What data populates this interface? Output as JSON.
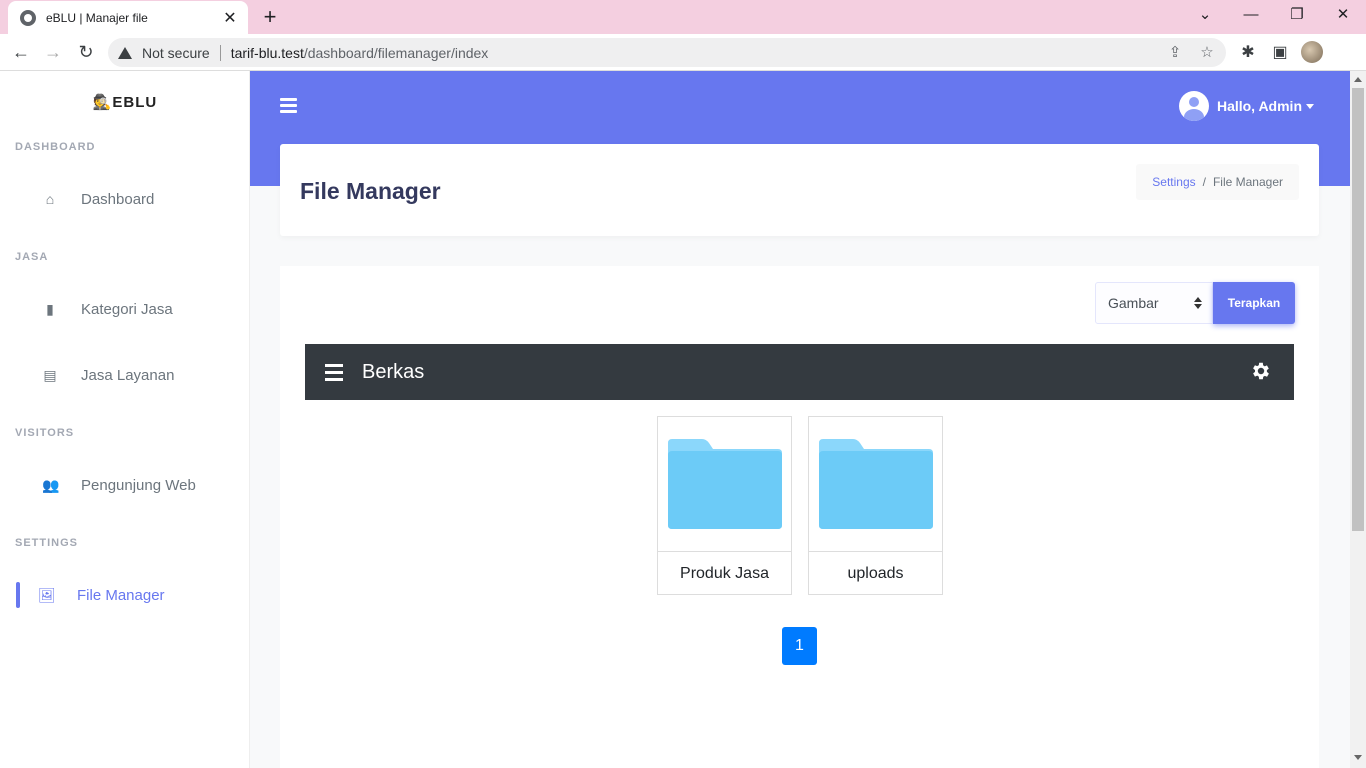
{
  "browser": {
    "tab_title": "eBLU | Manajer file",
    "tab_close": "✕",
    "new_tab": "+",
    "security": "Not secure",
    "url_host": "tarif-blu.test",
    "url_path": "/dashboard/filemanager/index"
  },
  "sidebar": {
    "brand": "EBLU",
    "sections": [
      {
        "heading": "DASHBOARD",
        "items": [
          {
            "label": "Dashboard",
            "icon": "home-icon"
          }
        ]
      },
      {
        "heading": "JASA",
        "items": [
          {
            "label": "Kategori Jasa",
            "icon": "bookmark-icon"
          },
          {
            "label": "Jasa Layanan",
            "icon": "list-icon"
          }
        ]
      },
      {
        "heading": "VISITORS",
        "items": [
          {
            "label": "Pengunjung Web",
            "icon": "users-icon"
          }
        ]
      },
      {
        "heading": "SETTINGS",
        "items": [
          {
            "label": "File Manager",
            "icon": "images-icon",
            "active": true
          }
        ]
      }
    ]
  },
  "topbar": {
    "user_greeting": "Hallo, Admin"
  },
  "header": {
    "title": "File Manager",
    "breadcrumb": {
      "parent": "Settings",
      "separator": "/",
      "current": "File Manager"
    }
  },
  "filter": {
    "selected": "Gambar",
    "apply_label": "Terapkan"
  },
  "filemanager": {
    "title": "Berkas",
    "folders": [
      {
        "name": "Produk Jasa"
      },
      {
        "name": "uploads"
      }
    ],
    "pagination": {
      "current_page": "1"
    }
  },
  "colors": {
    "accent": "#6777ef",
    "folder": "#6ccbf7",
    "dark_bar": "#343a40",
    "page_button": "#007bff"
  }
}
